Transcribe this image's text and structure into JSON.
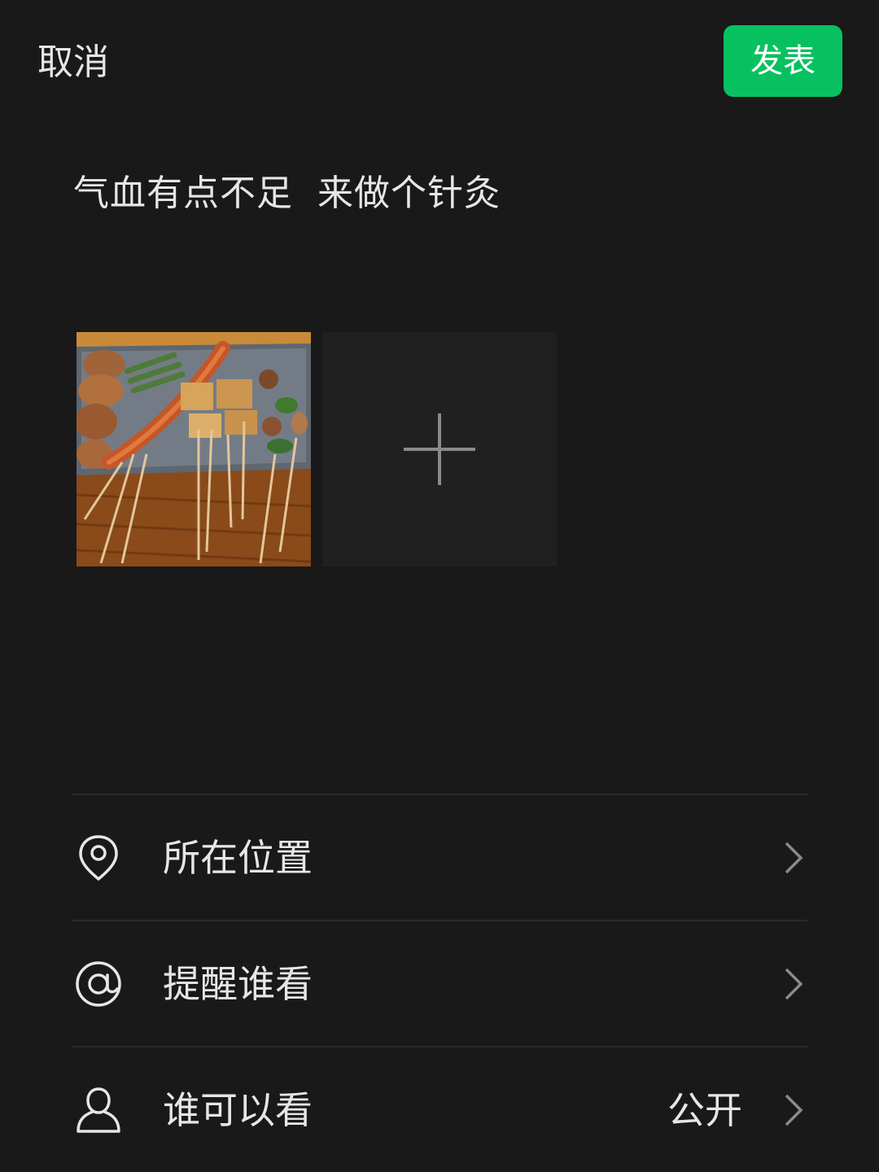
{
  "header": {
    "cancel_label": "取消",
    "publish_label": "发表",
    "publish_color": "#07c160"
  },
  "post": {
    "text": "气血有点不足  来做个针灸"
  },
  "media": {
    "photos": [
      {
        "icon": "food-photo-skewers"
      }
    ],
    "add_icon": "plus-icon"
  },
  "options": [
    {
      "label": "所在位置",
      "icon": "location-pin-icon",
      "value": ""
    },
    {
      "label": "提醒谁看",
      "icon": "at-icon",
      "value": ""
    },
    {
      "label": "谁可以看",
      "icon": "person-icon",
      "value": "公开"
    }
  ],
  "colors": {
    "background": "#191919",
    "text": "#e6e6e6",
    "divider": "#2b2b2b",
    "tile": "#202020"
  }
}
